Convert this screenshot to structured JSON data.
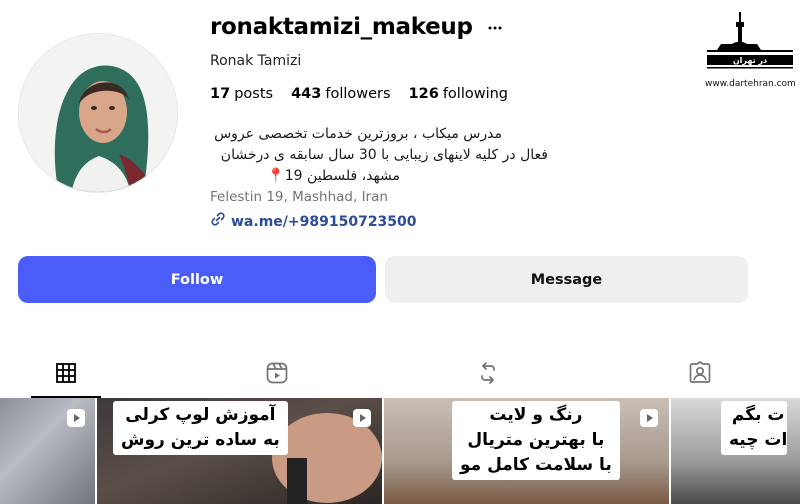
{
  "profile": {
    "username": "ronaktamizi_makeup",
    "full_name": "Ronak Tamizi",
    "stats": [
      {
        "count": "17",
        "label": "posts"
      },
      {
        "count": "443",
        "label": "followers"
      },
      {
        "count": "126",
        "label": "following"
      }
    ],
    "bio_lines": [
      "مدرس میکاب ، بروزترین خدمات تخصصی عروس",
      "فعال در کلیه لاینهای زیبایی با 30 سال سابقه ی درخشان",
      "مشهد، فلسطین 19📍"
    ],
    "location": "Felestin 19, Mashhad, Iran",
    "link": "wa.me/+989150723500"
  },
  "actions": {
    "follow_label": "Follow",
    "message_label": "Message"
  },
  "tabs": [
    {
      "icon": "grid-icon",
      "active": true
    },
    {
      "icon": "reels-icon",
      "active": false
    },
    {
      "icon": "reposts-icon",
      "active": false
    },
    {
      "icon": "tagged-icon",
      "active": false
    }
  ],
  "posts": [
    {
      "caption_lines": [],
      "type": "reel"
    },
    {
      "caption_lines": [
        "آموزش لوپ کرلی",
        "به ساده ترین روش"
      ],
      "type": "reel"
    },
    {
      "caption_lines": [
        "رنگ و لایت",
        "با بهترین متریال",
        "با سلامت کامل مو"
      ],
      "type": "reel"
    },
    {
      "caption_lines": [
        "ت بگم",
        "ات چیه"
      ],
      "type": "reel"
    }
  ],
  "watermark": {
    "logo_text": "در تهران",
    "url": "www.dartehran.com"
  },
  "colors": {
    "follow_bg": "#4a5df9",
    "message_bg": "#efefef",
    "link": "#2b4c9b",
    "muted": "#737373"
  }
}
